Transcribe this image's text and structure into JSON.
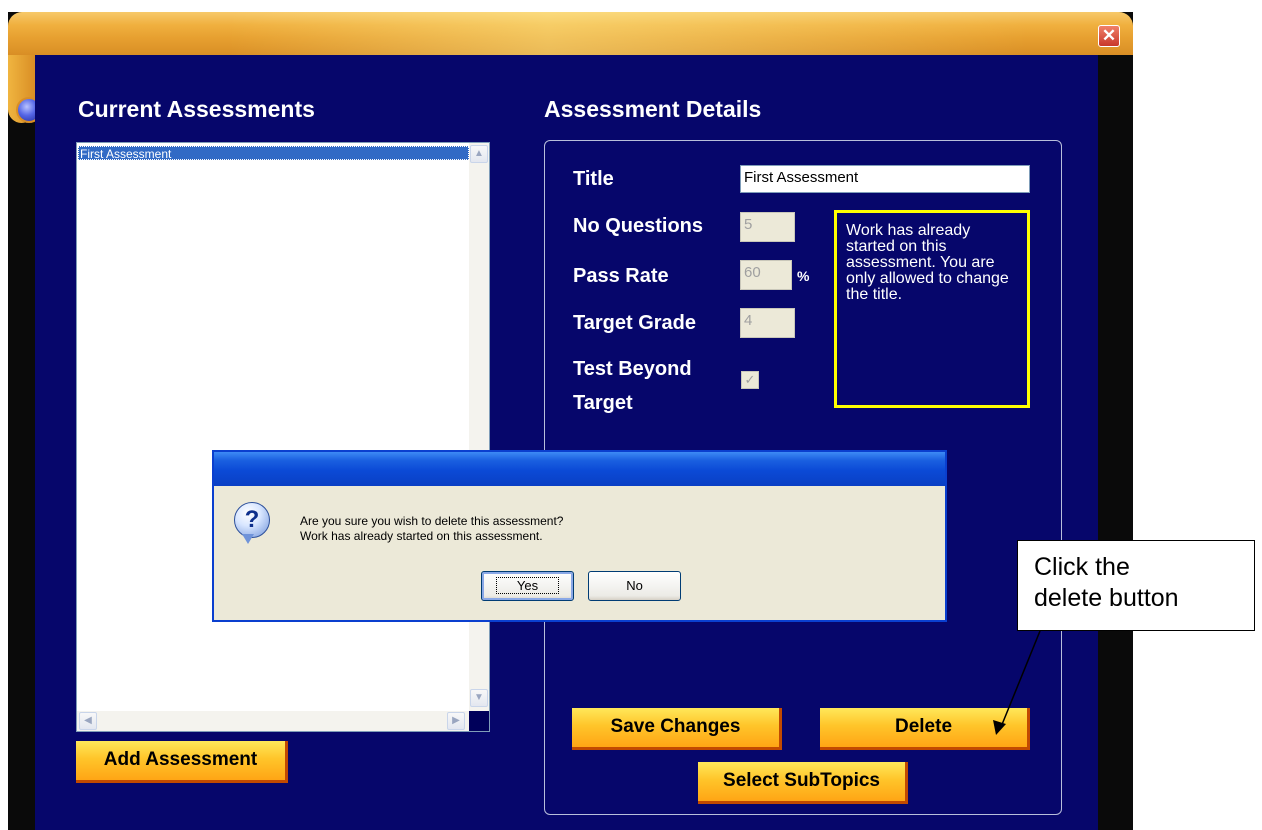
{
  "window": {
    "close_symbol": "✕"
  },
  "assessments": {
    "heading": "Current Assessments",
    "items": [
      "First Assessment"
    ],
    "selected_index": 0,
    "add_button": "Add Assessment"
  },
  "details": {
    "heading": "Assessment Details",
    "title_label": "Title",
    "title_value": "First Assessment",
    "questions_label": "No Questions",
    "questions_value": "5",
    "pass_rate_label": "Pass Rate",
    "pass_rate_value": "60",
    "pass_rate_unit": "%",
    "target_grade_label": "Target Grade",
    "target_grade_value": "4",
    "test_beyond_label_line1": "Test Beyond",
    "test_beyond_label_line2": "Target",
    "test_beyond_checked": true,
    "notice": "Work has already started on this assessment. You are only allowed to change the title.",
    "save_button": "Save Changes",
    "delete_button": "Delete",
    "subtopics_button": "Select SubTopics"
  },
  "dialog": {
    "message_line1": "Are you sure you wish to delete this assessment?",
    "message_line2": "Work has already started on this assessment.",
    "yes_button": "Yes",
    "no_button": "No",
    "icon": "question-icon"
  },
  "annotation": {
    "line1": "Click the",
    "line2": "delete button"
  }
}
